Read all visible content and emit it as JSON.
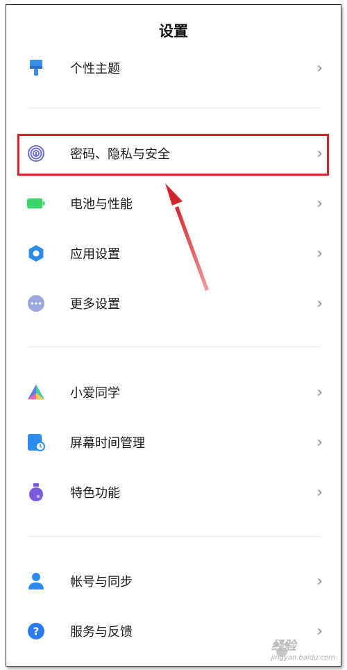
{
  "header": {
    "title": "设置"
  },
  "section1": {
    "items": [
      {
        "label": "个性主题",
        "icon": "theme-brush-icon"
      }
    ]
  },
  "section2": {
    "items": [
      {
        "label": "密码、隐私与安全",
        "icon": "fingerprint-icon"
      },
      {
        "label": "电池与性能",
        "icon": "battery-icon"
      },
      {
        "label": "应用设置",
        "icon": "gear-icon"
      },
      {
        "label": "更多设置",
        "icon": "more-dots-icon"
      }
    ]
  },
  "section3": {
    "items": [
      {
        "label": "小爱同学",
        "icon": "xiaoai-icon"
      },
      {
        "label": "屏幕时间管理",
        "icon": "screen-time-icon"
      },
      {
        "label": "特色功能",
        "icon": "flask-icon"
      }
    ]
  },
  "section4": {
    "items": [
      {
        "label": "帐号与同步",
        "icon": "account-icon"
      },
      {
        "label": "服务与反馈",
        "icon": "help-icon"
      }
    ]
  },
  "chevron": "›",
  "watermark": {
    "text": "经验",
    "subtext": "jingyan.baidu.com"
  },
  "colors": {
    "highlight": "#d4262d",
    "theme_icon": "#3a8ee6",
    "fingerprint_icon": "#6b6fd6",
    "battery_icon": "#3dd66a",
    "gear_icon": "#2b8cf0",
    "more_icon": "#9aa8e0",
    "screen_time_icon": "#2b8cf0",
    "flask_icon": "#7b5be0",
    "account_icon": "#2b8cf0",
    "help_icon": "#2b7cf0"
  }
}
